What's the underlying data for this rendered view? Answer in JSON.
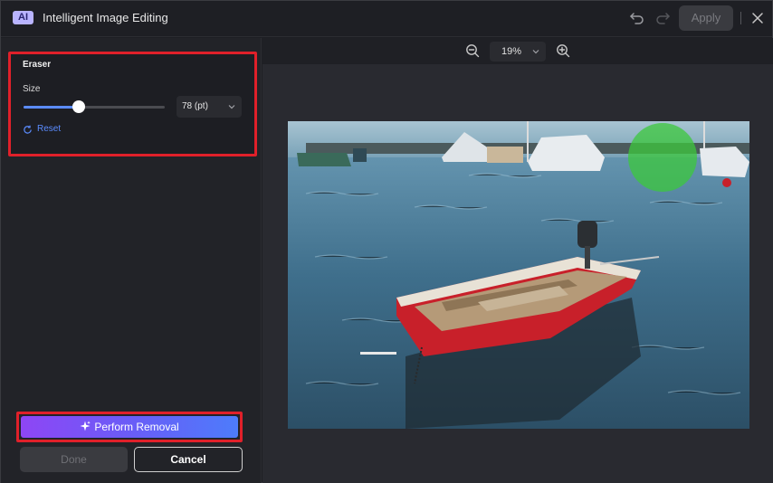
{
  "window": {
    "badge": "AI",
    "title": "Intelligent Image Editing",
    "apply_label": "Apply"
  },
  "eraser": {
    "title": "Eraser",
    "size_label": "Size",
    "size_value": "78 (pt)",
    "slider_fraction": 0.39,
    "reset_label": "Reset"
  },
  "actions": {
    "perform_label": "Perform Removal",
    "done_label": "Done",
    "cancel_label": "Cancel"
  },
  "zoom": {
    "value": "19%"
  },
  "colors": {
    "accent": "#5b8cff",
    "highlight_border": "#e0202a",
    "boat_hull": "#c8202a",
    "brush_overlay": "#3cc83c"
  },
  "icons": {
    "undo": "undo-icon",
    "redo": "redo-icon",
    "close": "close-icon",
    "zoom_out": "zoom-out-icon",
    "zoom_in": "zoom-in-icon",
    "reset": "reset-icon",
    "sparkle": "sparkle-icon"
  }
}
